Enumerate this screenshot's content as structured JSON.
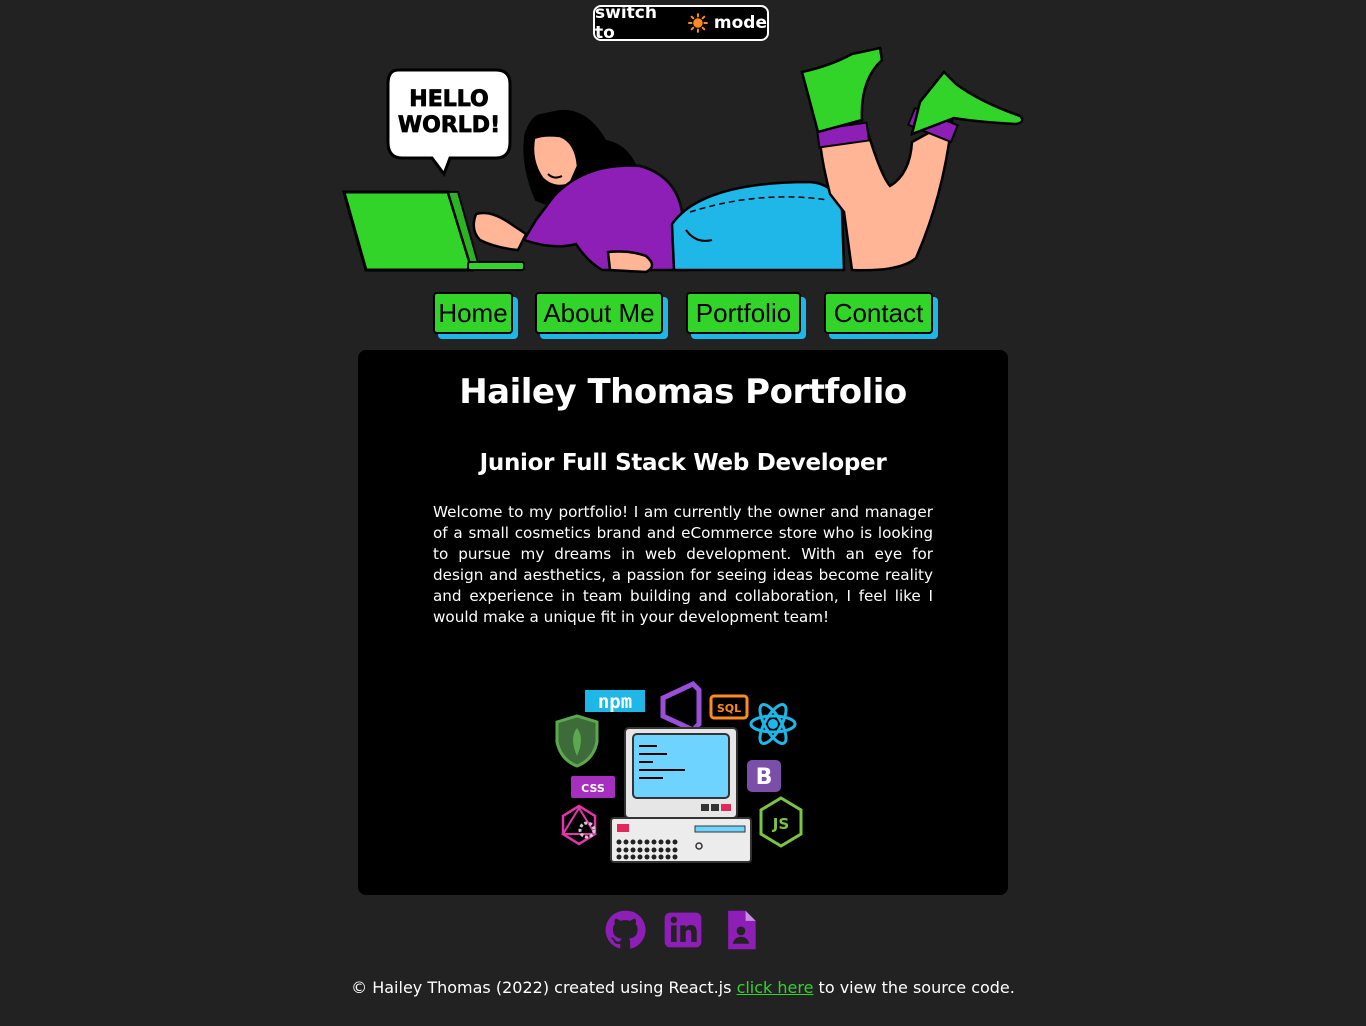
{
  "theme_toggle": {
    "prefix": "switch to",
    "icon": "sun-icon",
    "suffix": "mode"
  },
  "hero": {
    "bubble_line1": "HELLO",
    "bubble_line2": "WORLD!"
  },
  "nav": {
    "items": [
      "Home",
      "About Me",
      "Portfolio",
      "Contact"
    ]
  },
  "main": {
    "title": "Hailey Thomas Portfolio",
    "subtitle": "Junior Full Stack Web Developer",
    "intro": "Welcome to my portfolio! I am currently the owner and manager of a small cosmetics brand and eCommerce store who is looking to pursue my dreams in web development. With an eye for design and aesthetics, a passion for seeing ideas become reality and experience in team building and collaboration, I feel like I would make a unique fit in your development team!",
    "tech_labels": {
      "npm": "npm",
      "sql": "SQL",
      "css": "CSS",
      "bootstrap": "B",
      "node": "JS"
    }
  },
  "socials": {
    "icons": [
      "github-icon",
      "linkedin-icon",
      "resume-icon"
    ]
  },
  "footer": {
    "text_before": "© Hailey Thomas (2022) created using React.js",
    "link": "click here",
    "text_after": "to view the source code."
  },
  "colors": {
    "background": "#222222",
    "card": "#000000",
    "accent_green": "#33d42a",
    "accent_blue": "#1fb6e8",
    "accent_purple": "#8e1fb6"
  }
}
